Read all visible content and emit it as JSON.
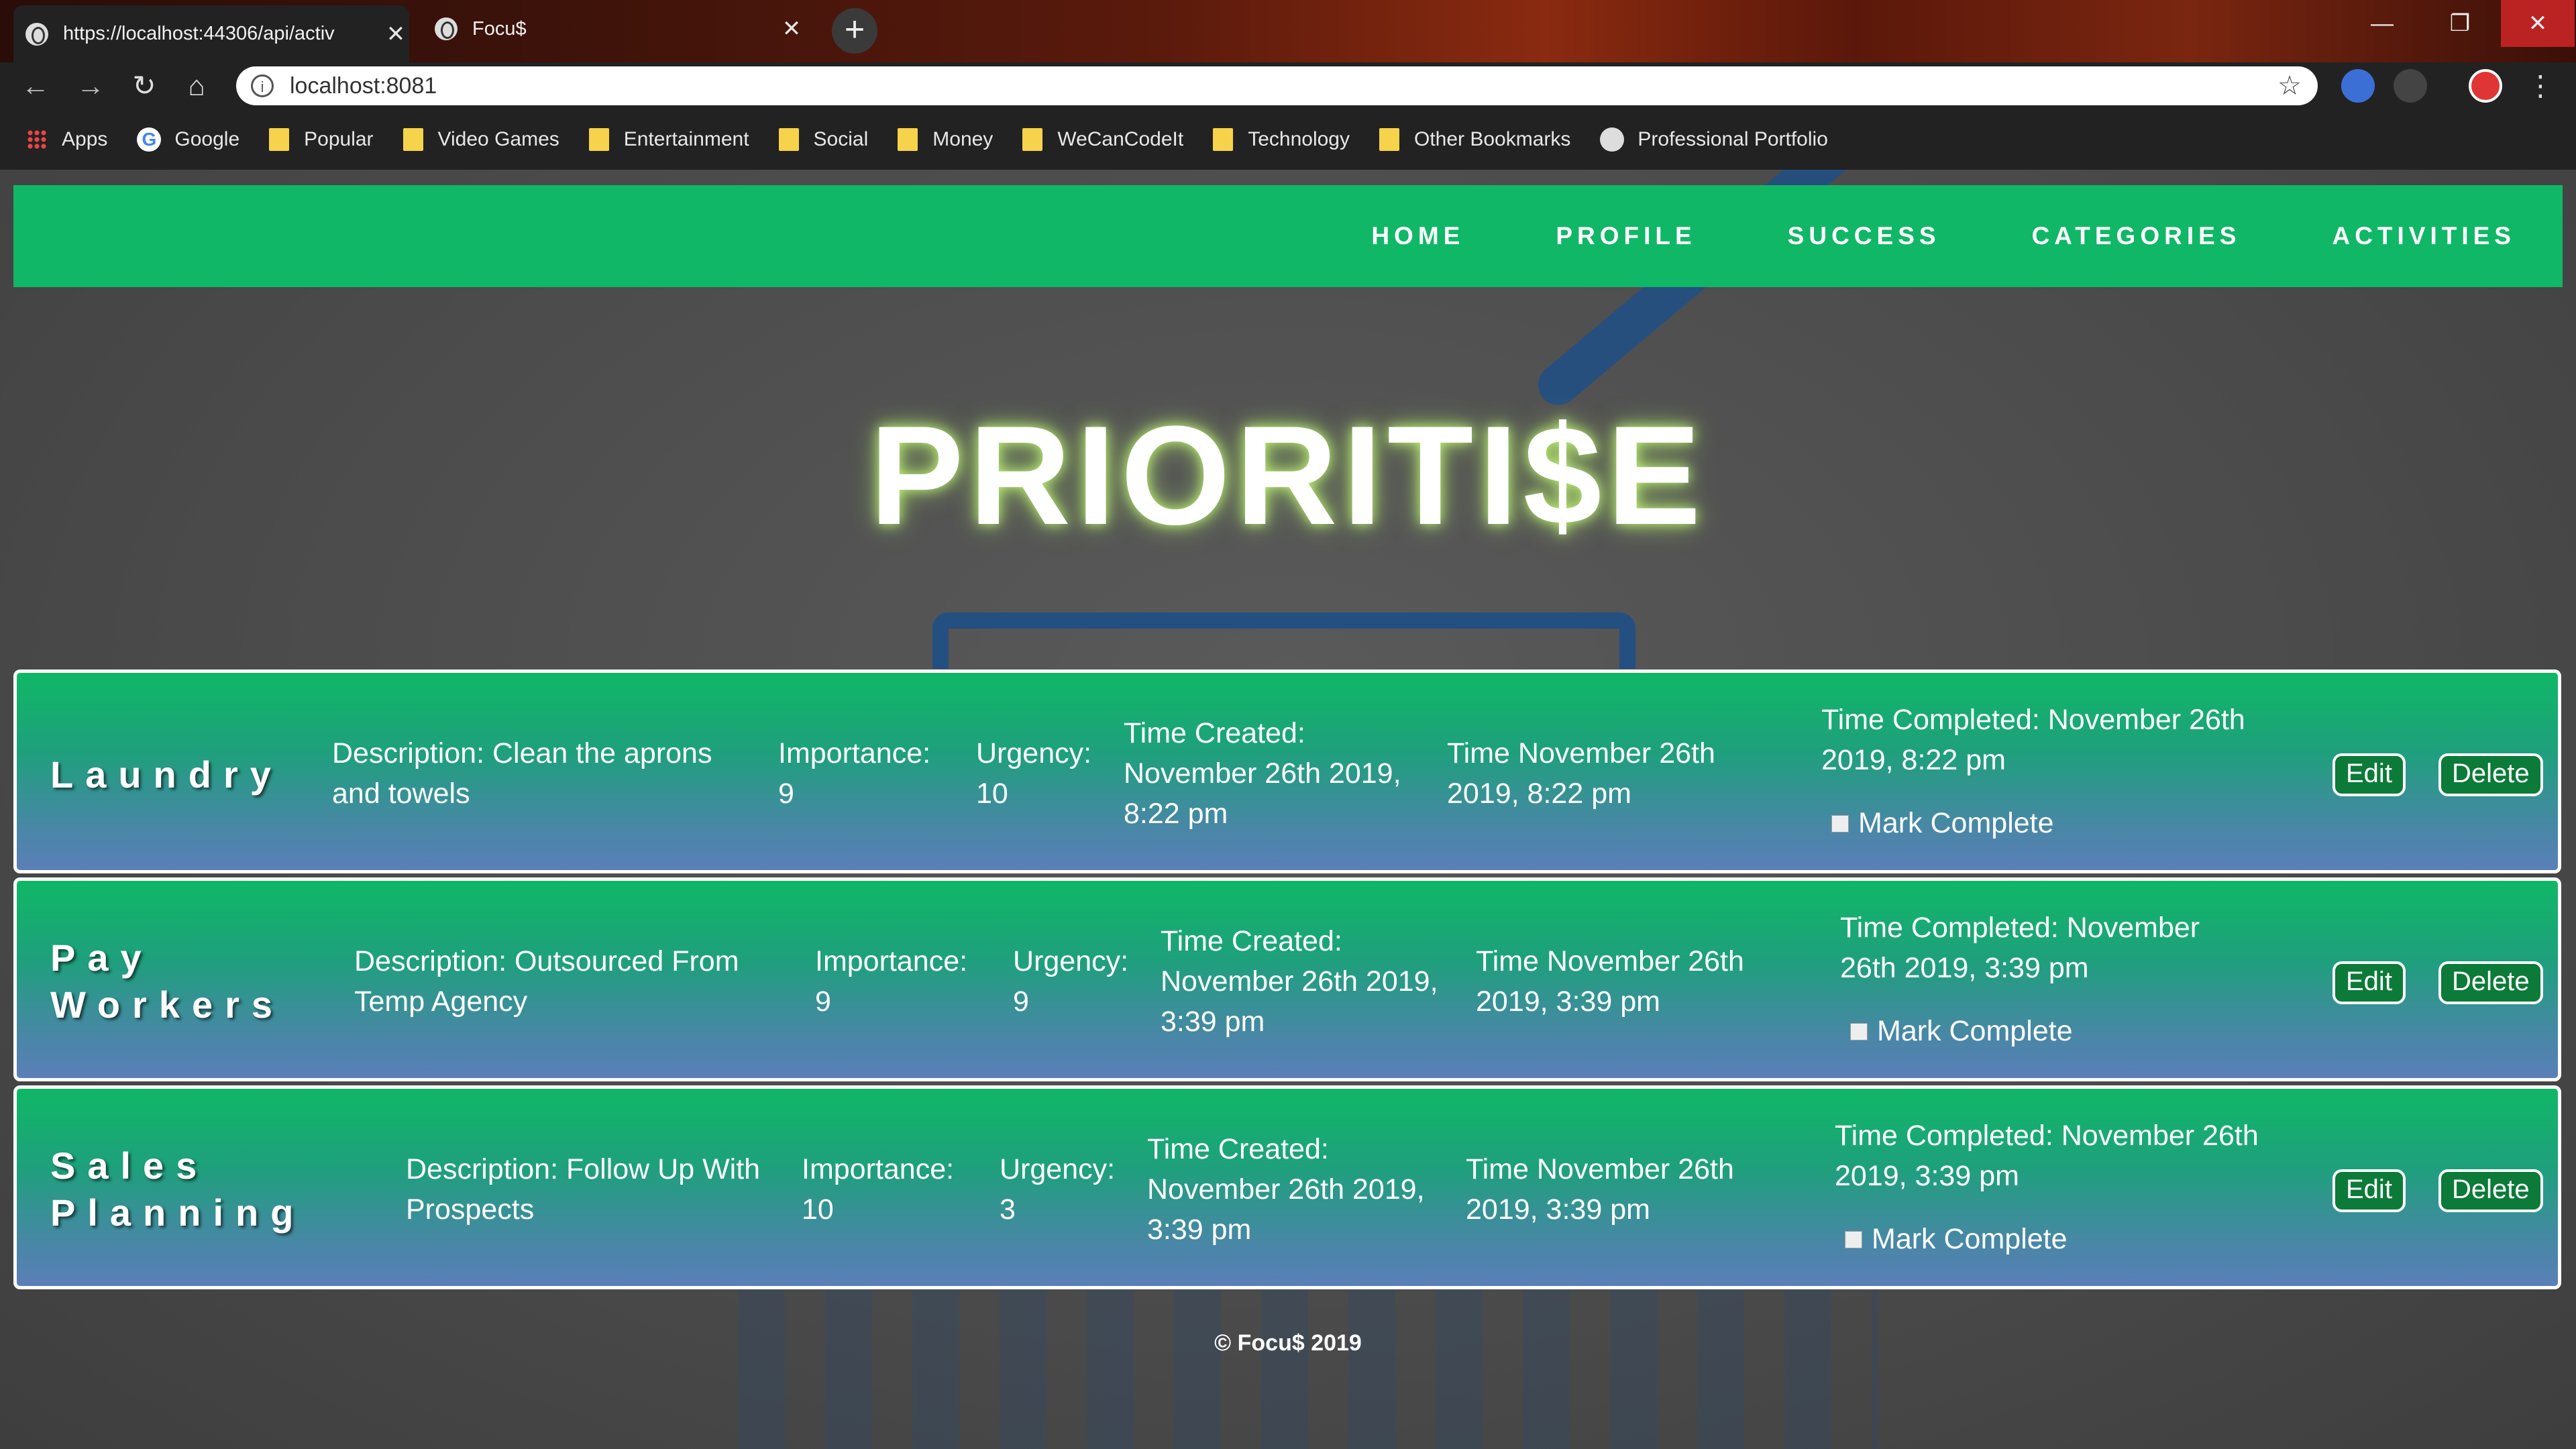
{
  "browser": {
    "tabs": [
      {
        "title": "https://localhost:44306/api/activ"
      },
      {
        "title": "Focu$"
      }
    ],
    "new_tab_icon": "+",
    "window_controls": {
      "minimize": "—",
      "restore": "❐",
      "close": "✕"
    },
    "address": {
      "url": "localhost:8081"
    },
    "bookmarks": [
      {
        "label": "Apps",
        "icon": "apps-icon"
      },
      {
        "label": "Google",
        "icon": "google-icon"
      },
      {
        "label": "Popular",
        "icon": "folder-icon"
      },
      {
        "label": "Video Games",
        "icon": "folder-icon"
      },
      {
        "label": "Entertainment",
        "icon": "folder-icon"
      },
      {
        "label": "Social",
        "icon": "folder-icon"
      },
      {
        "label": "Money",
        "icon": "folder-icon"
      },
      {
        "label": "WeCanCodeIt",
        "icon": "folder-icon"
      },
      {
        "label": "Technology",
        "icon": "folder-icon"
      },
      {
        "label": "Other Bookmarks",
        "icon": "folder-icon"
      },
      {
        "label": "Professional Portfolio",
        "icon": "globe-icon"
      }
    ]
  },
  "nav": {
    "items": [
      "HOME",
      "PROFILE",
      "SUCCESS",
      "CATEGORIES",
      "ACTIVITIES"
    ]
  },
  "hero": {
    "title": "PRIORITI$E"
  },
  "activities": [
    {
      "name": "Laundry",
      "description": "Description: Clean the aprons and towels",
      "importance_label": "Importance:",
      "importance": "9",
      "urgency_label": "Urgency:",
      "urgency": "10",
      "created": "Time Created: November 26th 2019, 8:22 pm",
      "time": "Time November 26th 2019, 8:22 pm",
      "completed": "Time Completed: November 26th 2019, 8:22 pm",
      "mark_complete": "Mark Complete",
      "edit": "Edit",
      "delete": "Delete"
    },
    {
      "name": "Pay Workers",
      "description": "Description: Outsourced From Temp Agency",
      "importance_label": "Importance:",
      "importance": "9",
      "urgency_label": "Urgency:",
      "urgency": "9",
      "created": "Time Created: November 26th 2019, 3:39 pm",
      "time": "Time November 26th 2019, 3:39 pm",
      "completed": "Time Completed: November 26th 2019, 3:39 pm",
      "mark_complete": "Mark Complete",
      "edit": "Edit",
      "delete": "Delete"
    },
    {
      "name": "Sales Planning",
      "description": "Description: Follow Up With Prospects",
      "importance_label": "Importance:",
      "importance": "10",
      "urgency_label": "Urgency:",
      "urgency": "3",
      "created": "Time Created: November 26th 2019, 3:39 pm",
      "time": "Time November 26th 2019, 3:39 pm",
      "completed": "Time Completed: November 26th 2019, 3:39 pm",
      "mark_complete": "Mark Complete",
      "edit": "Edit",
      "delete": "Delete"
    }
  ],
  "footer": {
    "text": "© Focu$ 2019"
  },
  "colors": {
    "brand_green": "#10b766",
    "card_blue": "#5a7fb8"
  }
}
